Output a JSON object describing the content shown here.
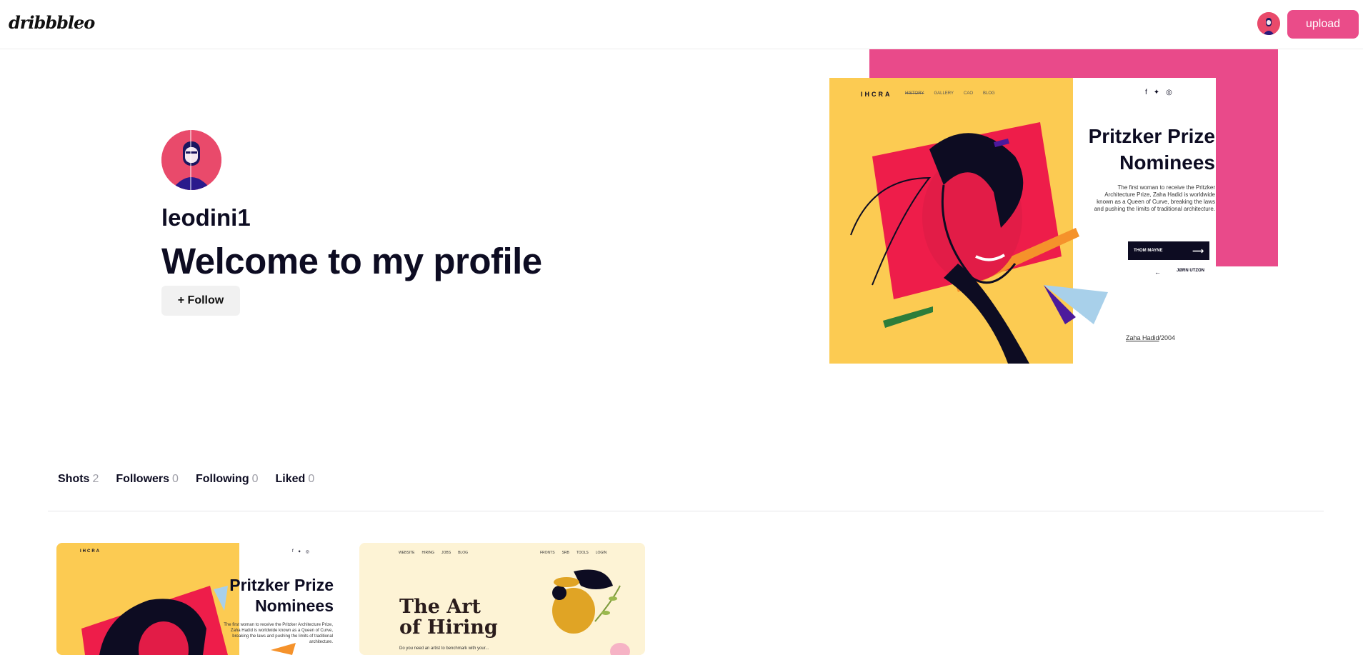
{
  "header": {
    "logo_text": "dribbbleo",
    "upload_label": "upload"
  },
  "profile": {
    "username": "leodini1",
    "welcome": "Welcome to my profile",
    "follow_label": "+ Follow"
  },
  "hero_shot": {
    "brand": "IHCRA",
    "nav": [
      "HISTORY",
      "GALLERY",
      "CAO",
      "BLOG"
    ],
    "title_line1": "Pritzker Prize",
    "title_line2": "Nominees",
    "description": "The first woman to receive the Pritzker Architecture Prize, Zaha Hadid is worldwide known as a Queen of Curve, breaking the laws and pushing the limits of traditional architecture.",
    "next_label": "THOM MAYNE",
    "prev_label": "JØRN UTZON",
    "caption_name": "Zaha Hadid",
    "caption_year": "/2004"
  },
  "stats": {
    "shots_label": "Shots",
    "shots_count": "2",
    "followers_label": "Followers",
    "followers_count": "0",
    "following_label": "Following",
    "following_count": "0",
    "liked_label": "Liked",
    "liked_count": "0"
  },
  "shots": [
    {
      "brand": "IHCRA",
      "title_line1": "Pritzker Prize",
      "title_line2": "Nominees",
      "description": "The first woman to receive the Pritzker Architecture Prize, Zaha Hadid is worldwide known as a Queen of Curve, breaking the laws and pushing the limits of traditional architecture."
    },
    {
      "nav_left": [
        "WEBSITE",
        "HIRING",
        "JOBS",
        "BLOG"
      ],
      "nav_right": [
        "FRONTS",
        "SRB",
        "TOOLS",
        "LOGIN"
      ],
      "title_line1": "The Art",
      "title_line2": "of Hiring",
      "description": "Do you need an artist to benchmark with your..."
    }
  ],
  "colors": {
    "accent": "#ea4c89",
    "hero_pink": "#e94a8a",
    "hero_yellow": "#fccb52",
    "hero_red": "#ee1d4a",
    "text_dark": "#0d0c22"
  }
}
